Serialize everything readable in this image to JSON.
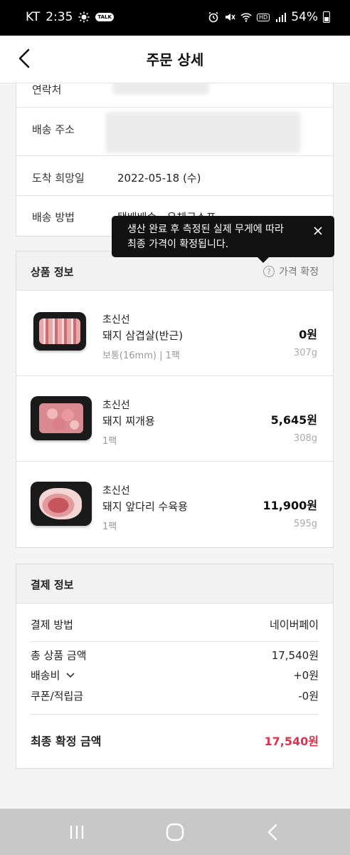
{
  "status_bar": {
    "carrier": "KT",
    "time": "2:35",
    "talk": "TALK",
    "hd": "HD",
    "battery": "54%"
  },
  "header": {
    "title": "주문 상세"
  },
  "info": {
    "contact_label": "연락처",
    "address_label": "배송 주소",
    "date_label": "도착 희망일",
    "date_value": "2022-05-18 (수)",
    "method_label": "배송 방법",
    "method_value": "택배배송 · 우체국소포"
  },
  "tooltip": {
    "line1": "생산 완료 후 측정된 실제 무게에 따라",
    "line2": "최종 가격이 확정됩니다."
  },
  "products": {
    "title": "상품 정보",
    "price_confirm": "가격 확정",
    "items": [
      {
        "brand": "초신선",
        "name": "돼지 삼겹살(반근)",
        "option": "보통(16mm)  |  1팩",
        "price": "0원",
        "weight": "307g"
      },
      {
        "brand": "초신선",
        "name": "돼지 찌개용",
        "option": "1팩",
        "price": "5,645원",
        "weight": "308g"
      },
      {
        "brand": "초신선",
        "name": "돼지 앞다리 수육용",
        "option": "1팩",
        "price": "11,900원",
        "weight": "595g"
      }
    ]
  },
  "payment": {
    "title": "결제 정보",
    "method_label": "결제 방법",
    "method_value": "네이버페이",
    "total_label": "총 상품 금액",
    "total_value": "17,540원",
    "shipping_label": "배송비",
    "shipping_value": "+0원",
    "coupon_label": "쿠폰/적립금",
    "coupon_value": "-0원",
    "final_label": "최종 확정 금액",
    "final_value": "17,540원"
  },
  "colors": {
    "accent": "#e0304a",
    "tooltip_bg": "#111111",
    "nav_bg": "#c8c8c8"
  }
}
